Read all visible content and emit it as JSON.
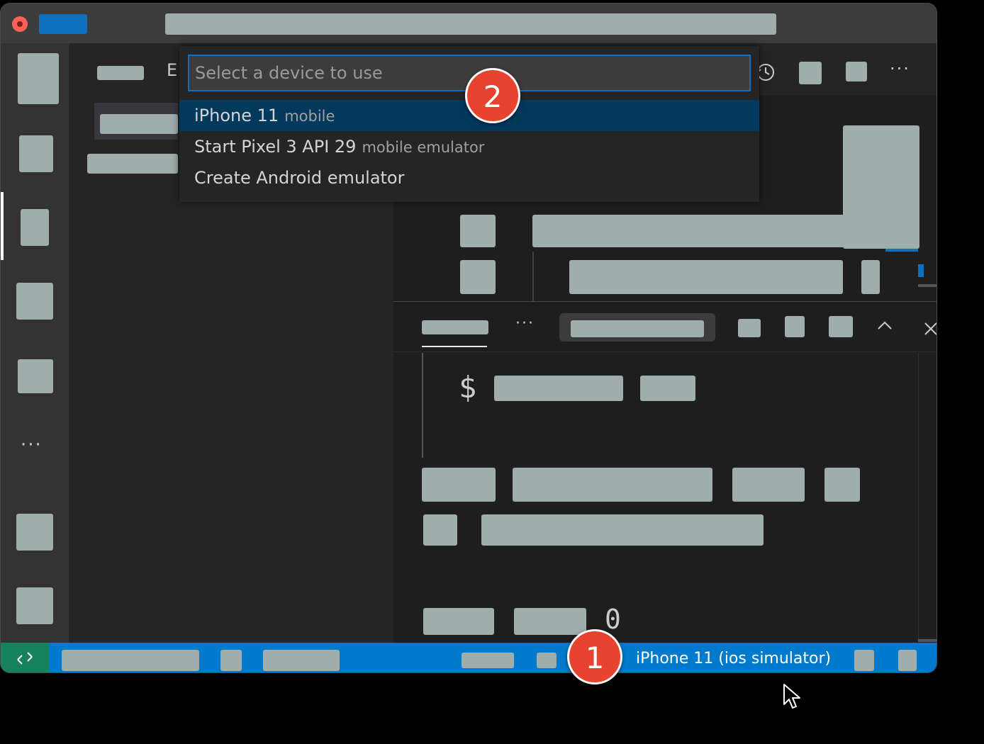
{
  "quickpick": {
    "placeholder": "Select a device to use",
    "items": [
      {
        "label": "iPhone 11",
        "description": "mobile"
      },
      {
        "label": "Start Pixel 3 API 29",
        "description": "mobile emulator"
      },
      {
        "label": "Create Android emulator",
        "description": ""
      }
    ]
  },
  "statusbar": {
    "device": "iPhone 11 (ios simulator)"
  },
  "terminal": {
    "prompt": "$",
    "digit": "0"
  },
  "badges": {
    "one": "1",
    "two": "2"
  },
  "icons": {
    "ellipsis": "···",
    "history": "history-icon",
    "chevron": "chevron-up-icon",
    "close": "close-icon",
    "remote": "remote-icon",
    "cursor": "mouse-cursor-icon"
  },
  "colors": {
    "statusbar": "#007acc",
    "remote": "#16825d",
    "selected": "#04395e",
    "focus": "#0e70c0",
    "badge": "#e8432e"
  }
}
